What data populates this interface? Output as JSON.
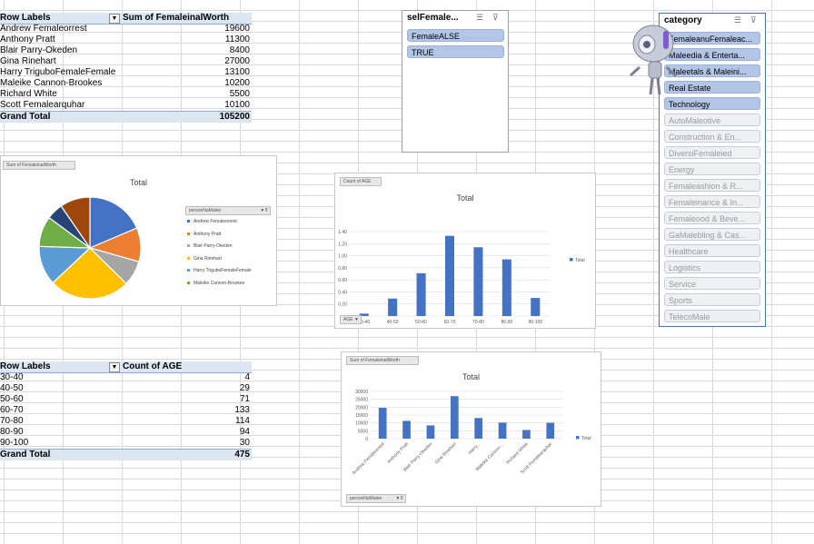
{
  "pivot1": {
    "header_label": "Row Labels",
    "header_value": "Sum of FemaleinalWorth",
    "rows": [
      {
        "label": "Andrew Femaleorrest",
        "value": "19600"
      },
      {
        "label": "Anthony Pratt",
        "value": "11300"
      },
      {
        "label": "Blair Parry-Okeden",
        "value": "8400"
      },
      {
        "label": "Gina Rinehart",
        "value": "27000"
      },
      {
        "label": "Harry TriguboFemaleFemale",
        "value": "13100"
      },
      {
        "label": "Maleike Cannon-Brookes",
        "value": "10200"
      },
      {
        "label": "Richard White",
        "value": "5500"
      },
      {
        "label": "Scott Femalearquhar",
        "value": "10100"
      }
    ],
    "total_label": "Grand Total",
    "total_value": "105200"
  },
  "pivot2": {
    "header_label": "Row Labels",
    "header_value": "Count of AGE",
    "rows": [
      {
        "label": "30-40",
        "value": "4"
      },
      {
        "label": "40-50",
        "value": "29"
      },
      {
        "label": "50-60",
        "value": "71"
      },
      {
        "label": "60-70",
        "value": "133"
      },
      {
        "label": "70-80",
        "value": "114"
      },
      {
        "label": "80-90",
        "value": "94"
      },
      {
        "label": "90-100",
        "value": "30"
      }
    ],
    "total_label": "Grand Total",
    "total_value": "475"
  },
  "slicer_self": {
    "title": "selFemale...",
    "items": [
      {
        "label": "FemaleALSE",
        "selected": true
      },
      {
        "label": "TRUE",
        "selected": true
      }
    ]
  },
  "slicer_category": {
    "title": "category",
    "items": [
      {
        "label": "FemaleanuFemaleac...",
        "selected": true
      },
      {
        "label": "Maleedia & Enterta...",
        "selected": true
      },
      {
        "label": "Maleetals & Maleini...",
        "selected": true
      },
      {
        "label": "Real Estate",
        "selected": true
      },
      {
        "label": "Technology",
        "selected": true
      },
      {
        "label": "AutoMaleotive",
        "selected": false
      },
      {
        "label": "Construction & En...",
        "selected": false
      },
      {
        "label": "DiversiFemaleied",
        "selected": false
      },
      {
        "label": "Energy",
        "selected": false
      },
      {
        "label": "Femaleashion & R...",
        "selected": false
      },
      {
        "label": "Femaleinance & In...",
        "selected": false
      },
      {
        "label": "Femaleood & Beve...",
        "selected": false
      },
      {
        "label": "GaMalebling & Cas...",
        "selected": false
      },
      {
        "label": "Healthcare",
        "selected": false
      },
      {
        "label": "Logistics",
        "selected": false
      },
      {
        "label": "Service",
        "selected": false
      },
      {
        "label": "Sports",
        "selected": false
      },
      {
        "label": "TelecoMale",
        "selected": false
      }
    ]
  },
  "colors": {
    "bar": "#4472c4",
    "pie": [
      "#4472c4",
      "#ed7d31",
      "#a5a5a5",
      "#ffc000",
      "#5b9bd5",
      "#70ad47",
      "#264478",
      "#9e480e"
    ]
  },
  "chart_data": [
    {
      "type": "pie",
      "field_button": "Sum of FemaleinalWorth",
      "title": "Total",
      "legend_field": "personNaMalee",
      "categories": [
        "Andrew Femaleorrest",
        "Anthony Pratt",
        "Blair Parry-Okeden",
        "Gina Rinehart",
        "Harry TriguboFemaleFemale",
        "Maleike Cannon-Brookes",
        "Richard White",
        "Scott Femalearquhar"
      ],
      "values": [
        19600,
        11300,
        8400,
        27000,
        13100,
        10200,
        5500,
        10100
      ],
      "legend_shown": [
        "Andrew Femaleorrest",
        "Anthony Pratt",
        "Blair Parry-Okeden",
        "Gina Rinehart",
        "Harry TriguboFemaleFemale",
        "Maleike Cannon-Brookes"
      ],
      "legend": "right"
    },
    {
      "type": "bar",
      "field_button": "Count of AGE",
      "axis_field": "AGE",
      "title": "Total",
      "categories": [
        "30-40",
        "40-50",
        "50-60",
        "60-70",
        "70-80",
        "80-90",
        "90-100"
      ],
      "values": [
        4,
        29,
        71,
        133,
        114,
        94,
        30
      ],
      "normalized_values": [
        0.04,
        0.29,
        0.71,
        1.33,
        1.14,
        0.94,
        0.3
      ],
      "ylim": [
        0,
        1.4
      ],
      "y_ticks": [
        "-",
        "0.20",
        "0.40",
        "0.60",
        "0.80",
        "1.00",
        "1.20",
        "1.40"
      ],
      "series": [
        {
          "name": "Total"
        }
      ],
      "legend": "right",
      "grid": true
    },
    {
      "type": "bar",
      "field_button": "Sum of FemaleinalWorth",
      "axis_field": "personNaMalee",
      "title": "Total",
      "categories": [
        "Andrew Femaleorrest",
        "Anthony Pratt",
        "Blair Parry-Okeden",
        "Gina Rinehart",
        "Harry...",
        "Maleike Cannon-...",
        "Richard White",
        "Scott Femalearquhar"
      ],
      "values": [
        19600,
        11300,
        8400,
        27000,
        13100,
        10200,
        5500,
        10100
      ],
      "ylim": [
        0,
        30000
      ],
      "y_ticks": [
        "0",
        "5000",
        "10000",
        "15000",
        "20000",
        "25000",
        "30000"
      ],
      "series": [
        {
          "name": "Total"
        }
      ],
      "legend": "right",
      "grid": true
    }
  ]
}
